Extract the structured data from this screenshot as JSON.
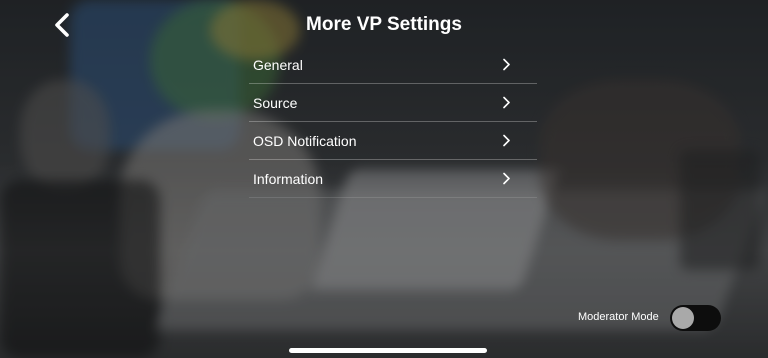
{
  "header": {
    "title": "More VP Settings",
    "back_icon": "chevron-left-icon"
  },
  "menu": {
    "items": [
      {
        "label": "General"
      },
      {
        "label": "Source"
      },
      {
        "label": "OSD Notification"
      },
      {
        "label": "Information"
      }
    ],
    "chevron_icon": "chevron-right-icon"
  },
  "moderator": {
    "label": "Moderator Mode",
    "enabled": false
  },
  "colors": {
    "text": "#ffffff",
    "toggle_track": "#0d0d0d",
    "toggle_knob": "#a9a9a9"
  }
}
